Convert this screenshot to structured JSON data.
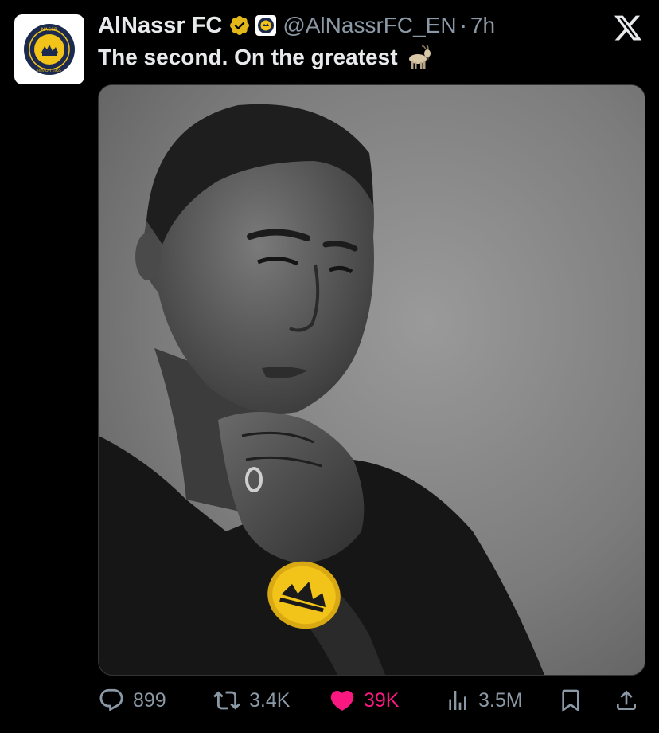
{
  "account": {
    "display_name": "AlNassr FC",
    "handle": "@AlNassrFC_EN",
    "separator": "·",
    "time": "7h",
    "avatar_text_top": "NASSR",
    "avatar_text_bottom": "RIYADH 1955"
  },
  "tweet": {
    "text": "The second. On the greatest",
    "emoji": "goat-icon"
  },
  "metrics": {
    "replies": "899",
    "reposts": "3.4K",
    "likes": "39K",
    "views": "3.5M"
  },
  "colors": {
    "background": "#000000",
    "like_pink": "#f91880",
    "muted_text": "#8b98a5",
    "verified_gold": "#e2b719",
    "nassr_yellow": "#f2c319",
    "nassr_navy": "#1b2a4e"
  },
  "icons": [
    "verified-badge-icon",
    "affiliate-logo-icon",
    "close-x-icon",
    "reply-icon",
    "repost-icon",
    "heart-icon",
    "views-icon",
    "bookmark-icon",
    "share-icon",
    "goat-icon"
  ]
}
